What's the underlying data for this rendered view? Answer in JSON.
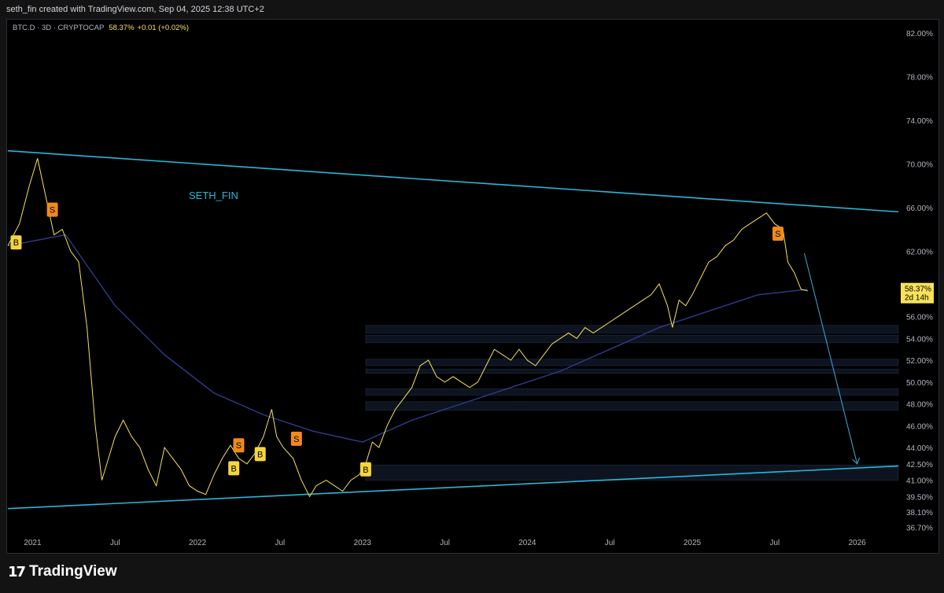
{
  "header": {
    "attribution": "seth_fin created with TradingView.com, Sep 04, 2025 12:38 UTC+2"
  },
  "symbol": {
    "label": "BTC.D · 3D · CRYPTOCAP",
    "price": "58.37%",
    "change": "+0.01 (+0.02%)"
  },
  "watermark": "SETH_FIN",
  "footer": {
    "brand": "TradingView"
  },
  "colors": {
    "price": "#f7e25a",
    "trendline": "#29b6d9",
    "ma": "#2f3a8c",
    "buy": "#f5d53b",
    "sell": "#f08a1c"
  },
  "chart_data": {
    "type": "line",
    "title": "",
    "xlabel": "",
    "ylabel": "",
    "x_ticks": [
      "2021",
      "Jul",
      "2022",
      "Jul",
      "2023",
      "Jul",
      "2024",
      "Jul",
      "2025",
      "Jul",
      "2026"
    ],
    "y_ticks": [
      "82.00%",
      "78.00%",
      "74.00%",
      "70.00%",
      "66.00%",
      "62.00%",
      "58.00%",
      "56.00%",
      "54.00%",
      "52.00%",
      "50.00%",
      "48.00%",
      "46.00%",
      "44.00%",
      "42.50%",
      "41.00%",
      "39.50%",
      "38.10%",
      "36.70%"
    ],
    "price_label": {
      "value": "58.37%",
      "countdown": "2d 14h"
    },
    "series": [
      {
        "values": [
          [
            2020.85,
            62.5
          ],
          [
            2020.92,
            64.5
          ],
          [
            2020.98,
            68
          ],
          [
            2021.03,
            70.5
          ],
          [
            2021.08,
            67
          ],
          [
            2021.13,
            63.5
          ],
          [
            2021.18,
            64
          ],
          [
            2021.23,
            62
          ],
          [
            2021.28,
            61
          ],
          [
            2021.33,
            55
          ],
          [
            2021.38,
            46
          ],
          [
            2021.42,
            41
          ],
          [
            2021.46,
            43
          ],
          [
            2021.5,
            45
          ],
          [
            2021.55,
            46.5
          ],
          [
            2021.6,
            45
          ],
          [
            2021.65,
            44
          ],
          [
            2021.7,
            42
          ],
          [
            2021.75,
            40.5
          ],
          [
            2021.8,
            44
          ],
          [
            2021.85,
            43
          ],
          [
            2021.9,
            42
          ],
          [
            2021.95,
            40.5
          ],
          [
            2022.0,
            40
          ],
          [
            2022.05,
            39.7
          ],
          [
            2022.1,
            41.5
          ],
          [
            2022.15,
            43
          ],
          [
            2022.2,
            44.2
          ],
          [
            2022.25,
            43
          ],
          [
            2022.3,
            42.5
          ],
          [
            2022.35,
            43.5
          ],
          [
            2022.4,
            45
          ],
          [
            2022.45,
            47.5
          ],
          [
            2022.48,
            45
          ],
          [
            2022.52,
            44
          ],
          [
            2022.58,
            43
          ],
          [
            2022.63,
            41
          ],
          [
            2022.68,
            39.5
          ],
          [
            2022.72,
            40.5
          ],
          [
            2022.78,
            41
          ],
          [
            2022.83,
            40.5
          ],
          [
            2022.88,
            40
          ],
          [
            2022.93,
            41
          ],
          [
            2022.98,
            41.5
          ],
          [
            2023.02,
            42.5
          ],
          [
            2023.06,
            44.5
          ],
          [
            2023.1,
            44
          ],
          [
            2023.15,
            46
          ],
          [
            2023.2,
            47.5
          ],
          [
            2023.25,
            48.5
          ],
          [
            2023.3,
            49.5
          ],
          [
            2023.35,
            51.5
          ],
          [
            2023.4,
            52
          ],
          [
            2023.45,
            50.5
          ],
          [
            2023.5,
            50
          ],
          [
            2023.55,
            50.5
          ],
          [
            2023.6,
            50
          ],
          [
            2023.65,
            49.5
          ],
          [
            2023.7,
            50
          ],
          [
            2023.75,
            51.5
          ],
          [
            2023.8,
            53
          ],
          [
            2023.85,
            52.5
          ],
          [
            2023.9,
            52
          ],
          [
            2023.95,
            53
          ],
          [
            2024.0,
            52
          ],
          [
            2024.05,
            51.5
          ],
          [
            2024.1,
            52.5
          ],
          [
            2024.15,
            53.5
          ],
          [
            2024.2,
            54
          ],
          [
            2024.25,
            54.5
          ],
          [
            2024.3,
            54
          ],
          [
            2024.35,
            55
          ],
          [
            2024.4,
            54.5
          ],
          [
            2024.45,
            55
          ],
          [
            2024.5,
            55.5
          ],
          [
            2024.55,
            56
          ],
          [
            2024.6,
            56.5
          ],
          [
            2024.65,
            57
          ],
          [
            2024.7,
            57.5
          ],
          [
            2024.75,
            58
          ],
          [
            2024.8,
            59
          ],
          [
            2024.85,
            57
          ],
          [
            2024.88,
            55
          ],
          [
            2024.92,
            57.5
          ],
          [
            2024.96,
            57
          ],
          [
            2025.0,
            58
          ],
          [
            2025.05,
            59.5
          ],
          [
            2025.1,
            61
          ],
          [
            2025.15,
            61.5
          ],
          [
            2025.2,
            62.5
          ],
          [
            2025.25,
            63
          ],
          [
            2025.3,
            64
          ],
          [
            2025.35,
            64.5
          ],
          [
            2025.4,
            65
          ],
          [
            2025.45,
            65.5
          ],
          [
            2025.5,
            64.5
          ],
          [
            2025.55,
            64
          ],
          [
            2025.58,
            61
          ],
          [
            2025.62,
            60
          ],
          [
            2025.66,
            58.5
          ],
          [
            2025.7,
            58.37
          ]
        ]
      },
      {
        "values": [
          [
            2020.85,
            62.5
          ],
          [
            2021.2,
            63.5
          ],
          [
            2021.5,
            57
          ],
          [
            2021.8,
            52.5
          ],
          [
            2022.1,
            49
          ],
          [
            2022.4,
            47
          ],
          [
            2022.7,
            45.5
          ],
          [
            2023.0,
            44.5
          ],
          [
            2023.3,
            46.5
          ],
          [
            2023.6,
            48
          ],
          [
            2023.9,
            49.5
          ],
          [
            2024.2,
            51
          ],
          [
            2024.5,
            53
          ],
          [
            2024.8,
            55
          ],
          [
            2025.1,
            56.5
          ],
          [
            2025.4,
            58
          ],
          [
            2025.7,
            58.5
          ]
        ]
      }
    ],
    "signals": [
      {
        "label": "B",
        "x": 2020.9,
        "y": 62.8
      },
      {
        "label": "S",
        "x": 2021.12,
        "y": 65.8
      },
      {
        "label": "S",
        "x": 2022.25,
        "y": 44.2
      },
      {
        "label": "B",
        "x": 2022.22,
        "y": 42.1
      },
      {
        "label": "B",
        "x": 2022.38,
        "y": 43.4
      },
      {
        "label": "S",
        "x": 2022.6,
        "y": 44.8
      },
      {
        "label": "B",
        "x": 2023.02,
        "y": 42.0
      },
      {
        "label": "S",
        "x": 2025.52,
        "y": 63.6
      }
    ],
    "trendlines": [
      {
        "from": [
          2020.85,
          71.2
        ],
        "to": [
          2026.25,
          65.6
        ]
      },
      {
        "from": [
          2020.85,
          38.4
        ],
        "to": [
          2026.25,
          42.3
        ]
      }
    ],
    "projection": {
      "from": [
        2025.68,
        61.8
      ],
      "to": [
        2026.0,
        42.5
      ]
    },
    "zones": [
      [
        54.5,
        55.2
      ],
      [
        53.6,
        54.3
      ],
      [
        51.5,
        52.1
      ],
      [
        50.8,
        51.2
      ],
      [
        48.8,
        49.4
      ],
      [
        47.4,
        48.2
      ],
      [
        41.0,
        42.4
      ]
    ],
    "ylim": [
      36.0,
      83.0
    ],
    "xlim": [
      2020.85,
      2026.25
    ],
    "grid": false,
    "legend": "none"
  }
}
